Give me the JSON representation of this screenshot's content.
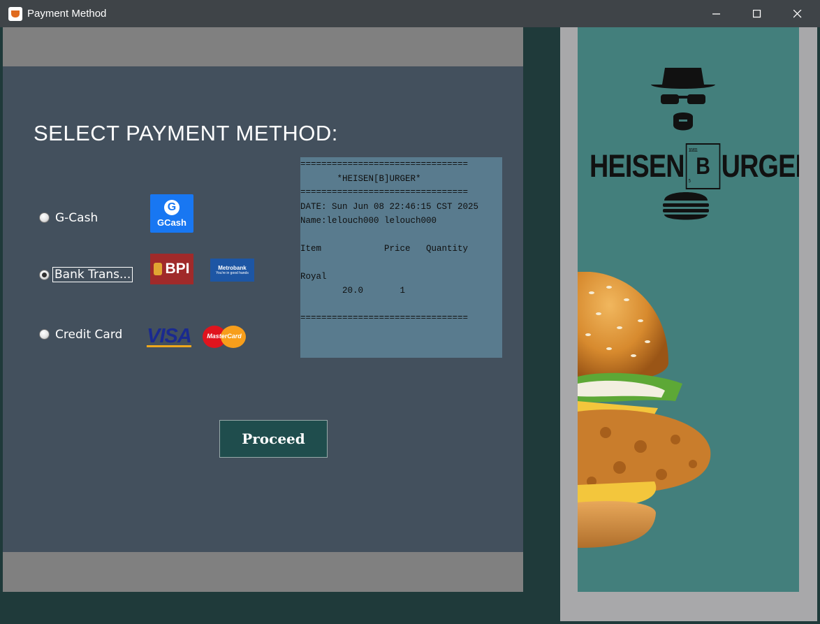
{
  "window": {
    "title": "Payment Method",
    "controls": {
      "minimize": "minimize-icon",
      "maximize": "maximize-icon",
      "close": "close-icon"
    }
  },
  "main": {
    "heading": "SELECT PAYMENT METHOD:",
    "options": [
      {
        "label": "G-Cash",
        "selected": false,
        "logos": [
          "GCash"
        ]
      },
      {
        "label": "Bank Trans...",
        "selected": true,
        "focused": true,
        "logos": [
          "BPI",
          "Metrobank"
        ]
      },
      {
        "label": "Credit Card",
        "selected": false,
        "logos": [
          "VISA",
          "MasterCard"
        ]
      }
    ],
    "logos": {
      "gcash": "GCash",
      "bpi": "BPI",
      "metrobank": "Metrobank",
      "metrobank_tagline": "You're in good hands",
      "visa": "VISA",
      "mastercard": "MasterCard"
    },
    "proceed_label": "Proceed"
  },
  "receipt": {
    "lines": [
      "================================",
      "       *HEISEN[B]URGER*",
      "================================",
      "DATE: Sun Jun 08 22:46:15 CST 2025",
      "Name:lelouch000 lelouch000",
      "",
      "Item            Price   Quantity",
      "",
      "Royal",
      "        20.0       1",
      "",
      "================================"
    ]
  },
  "brand": {
    "left": "HEISEN",
    "tile_letter": "B",
    "tile_number": "10.811",
    "tile_atomic": "5",
    "right": "URGER"
  },
  "colors": {
    "title_bar": "#3f4448",
    "left_panel": "#43505d",
    "receipt_bg": "#597b8e",
    "proceed_bg": "#1f4d4d",
    "right_panel": "#437f7c",
    "window_bg": "#1f3a3a"
  }
}
